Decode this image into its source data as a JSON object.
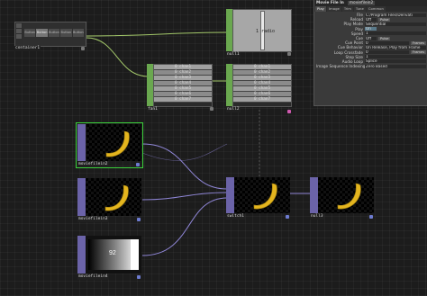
{
  "nodes": {
    "container1": {
      "label": "container1",
      "tabs": [
        "Button",
        "Button",
        "Button",
        "Button",
        "Button"
      ]
    },
    "null1": {
      "label": "null1",
      "overlay_text": "1 radio"
    },
    "fan1": {
      "label": "fan1",
      "channels": [
        "0 chan1",
        "0 chan2",
        "0 chan3",
        "0 chan4",
        "0 chan5",
        "0 chan6",
        "0 chan7"
      ]
    },
    "null2": {
      "label": "null2",
      "channels": [
        "0 chan1",
        "0 chan2",
        "0 chan3",
        "0 chan4",
        "0 chan5",
        "0 chan6",
        "0 chan7"
      ]
    },
    "moviefilein2": {
      "label": "moviefilein2"
    },
    "moviefilein3": {
      "label": "moviefilein3"
    },
    "moviefilein4": {
      "label": "moviefilein4",
      "overlay_text": "92"
    },
    "switch1": {
      "label": "switch1"
    },
    "null3": {
      "label": "null3"
    }
  },
  "panel": {
    "header": {
      "type": "Movie File In",
      "name": "moviefilein2"
    },
    "tabs": [
      "Play",
      "Image",
      "Trim",
      "Tune",
      "Common"
    ],
    "active_tab": "Play",
    "params": [
      {
        "label": "File",
        "value": "C:/Program Files/Derivati"
      },
      {
        "label": "Reload",
        "value": "Off",
        "extra": "Pulse"
      },
      {
        "label": "Play Mode",
        "value": "Sequential"
      },
      {
        "label": "Play",
        "value": "On"
      },
      {
        "label": "Speed",
        "value": "1"
      },
      {
        "label": "Cue",
        "value": "Off",
        "extra": "Pulse"
      },
      {
        "label": "Cue Point",
        "value": "0",
        "extra": "Frames"
      },
      {
        "label": "Cue Behavior",
        "value": "On Release, Play from Frame"
      },
      {
        "label": "Loop Crossfade",
        "value": "0",
        "extra": "Frames"
      },
      {
        "label": "Step Size",
        "value": "1"
      },
      {
        "label": "Audio Loop",
        "value": "Splice"
      },
      {
        "label": "Image Sequence Indexing",
        "value": "Zero Based"
      }
    ]
  },
  "colors": {
    "chop_accent": "#6aa84f",
    "top_accent": "#6b63a8",
    "selected_border": "#3bd13b",
    "wire_chop": "#a3c86a",
    "wire_top": "#8f86d6",
    "flag_active": "#d05ab0"
  }
}
